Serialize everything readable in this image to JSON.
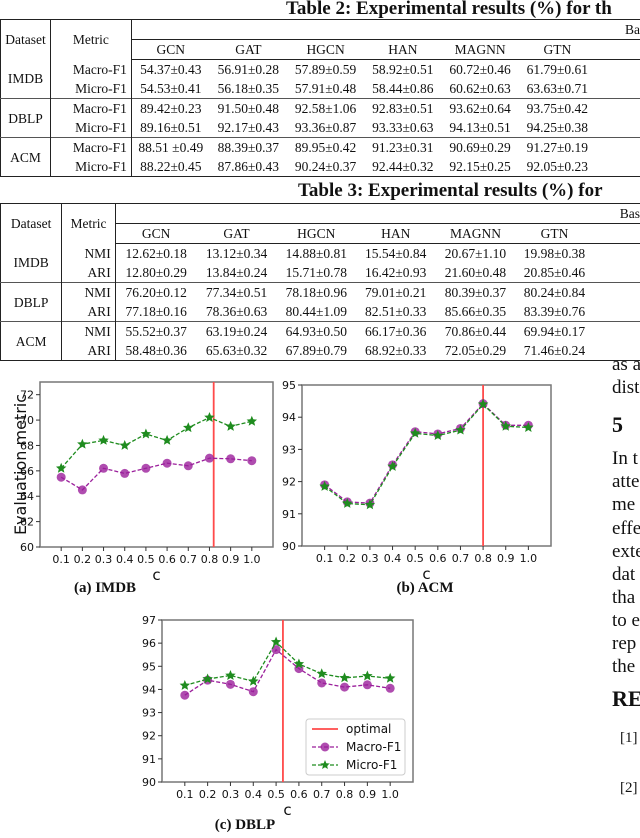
{
  "table2": {
    "title": "Table 2: Experimental results (%) for th",
    "group_header": "Ba",
    "headers": [
      "Dataset",
      "Metric",
      "GCN",
      "GAT",
      "HGCN",
      "HAN",
      "MAGNN",
      "GTN"
    ],
    "groups": [
      {
        "dataset": "IMDB",
        "rows": [
          {
            "metric": "Macro-F1",
            "values": [
              "54.37±0.43",
              "56.91±0.28",
              "57.89±0.59",
              "58.92±0.51",
              "60.72±0.46",
              "61.79±0.61"
            ]
          },
          {
            "metric": "Micro-F1",
            "values": [
              "54.53±0.41",
              "56.18±0.35",
              "57.91±0.48",
              "58.44±0.86",
              "60.62±0.63",
              "63.63±0.71"
            ]
          }
        ]
      },
      {
        "dataset": "DBLP",
        "rows": [
          {
            "metric": "Macro-F1",
            "values": [
              "89.42±0.23",
              "91.50±0.48",
              "92.58±1.06",
              "92.83±0.51",
              "93.62±0.64",
              "93.75±0.42"
            ]
          },
          {
            "metric": "Micro-F1",
            "values": [
              "89.16±0.51",
              "92.17±0.43",
              "93.36±0.87",
              "93.33±0.63",
              "94.13±0.51",
              "94.25±0.38"
            ]
          }
        ]
      },
      {
        "dataset": "ACM",
        "rows": [
          {
            "metric": "Macro-F1",
            "values": [
              "88.51 ±0.49",
              "88.39±0.37",
              "89.95±0.42",
              "91.23±0.31",
              "90.69±0.29",
              "91.27±0.19"
            ]
          },
          {
            "metric": "Micro-F1",
            "values": [
              "88.22±0.45",
              "87.86±0.43",
              "90.24±0.37",
              "92.44±0.32",
              "92.15±0.25",
              "92.05±0.23"
            ]
          }
        ]
      }
    ]
  },
  "table3": {
    "title": "Table 3: Experimental results (%) for",
    "group_header": "Bas",
    "headers": [
      "Dataset",
      "Metric",
      "GCN",
      "GAT",
      "HGCN",
      "HAN",
      "MAGNN",
      "GTN"
    ],
    "groups": [
      {
        "dataset": "IMDB",
        "rows": [
          {
            "metric": "NMI",
            "values": [
              "12.62±0.18",
              "13.12±0.34",
              "14.88±0.81",
              "15.54±0.84",
              "20.67±1.10",
              "19.98±0.38"
            ]
          },
          {
            "metric": "ARI",
            "values": [
              "12.80±0.29",
              "13.84±0.24",
              "15.71±0.78",
              "16.42±0.93",
              "21.60±0.48",
              "20.85±0.46"
            ]
          }
        ]
      },
      {
        "dataset": "DBLP",
        "rows": [
          {
            "metric": "NMI",
            "values": [
              "76.20±0.12",
              "77.34±0.51",
              "78.18±0.96",
              "79.01±0.21",
              "80.39±0.37",
              "80.24±0.84"
            ]
          },
          {
            "metric": "ARI",
            "values": [
              "77.18±0.16",
              "78.36±0.63",
              "80.44±1.09",
              "82.51±0.33",
              "85.66±0.35",
              "83.39±0.76"
            ]
          }
        ]
      },
      {
        "dataset": "ACM",
        "rows": [
          {
            "metric": "NMI",
            "values": [
              "55.52±0.37",
              "63.19±0.24",
              "64.93±0.50",
              "66.17±0.36",
              "70.86±0.44",
              "69.94±0.17"
            ]
          },
          {
            "metric": "ARI",
            "values": [
              "58.48±0.36",
              "65.63±0.32",
              "67.89±0.79",
              "68.92±0.33",
              "72.05±0.29",
              "71.46±0.24"
            ]
          }
        ]
      }
    ]
  },
  "side_text": {
    "lines": [
      "as a",
      "dist",
      "In t",
      "atte",
      "me",
      "effe",
      "exte",
      "dat",
      "tha",
      "to e",
      "rep",
      "the"
    ],
    "heading": "5",
    "refs_heading": "RE",
    "refs": [
      "[1]",
      "[2]"
    ]
  },
  "colors": {
    "macro": "#9b1f9b",
    "micro": "#1f8c1f",
    "optimal": "#ff4a4a"
  },
  "chart_data": [
    {
      "type": "line",
      "caption": "(a) IMDB",
      "xlabel": "c",
      "ylabel": "Evaluation metric",
      "x": [
        0.1,
        0.2,
        0.3,
        0.4,
        0.5,
        0.6,
        0.7,
        0.8,
        0.9,
        1.0
      ],
      "xtick_labels": [
        "0.1",
        "0.2",
        "0.3",
        "0.4",
        "0.5",
        "0.6",
        "0.7",
        "0.8",
        "0.9",
        "1.0"
      ],
      "xlim": [
        0,
        1.1
      ],
      "ylim": [
        60,
        73
      ],
      "yticks": [
        60,
        62,
        64,
        66,
        68,
        70,
        72
      ],
      "grid": false,
      "optimal_x": 0.82,
      "series": [
        {
          "name": "Macro-F1",
          "marker": "circle",
          "values": [
            65.5,
            64.5,
            66.2,
            65.8,
            66.2,
            66.6,
            66.4,
            67.0,
            66.95,
            66.8
          ]
        },
        {
          "name": "Micro-F1",
          "marker": "star",
          "values": [
            66.2,
            68.1,
            68.4,
            68.0,
            68.9,
            68.4,
            69.4,
            70.2,
            69.5,
            69.9
          ]
        }
      ]
    },
    {
      "type": "line",
      "caption": "(b) ACM",
      "xlabel": "c",
      "ylabel": "",
      "x": [
        0.1,
        0.2,
        0.3,
        0.4,
        0.5,
        0.6,
        0.7,
        0.8,
        0.9,
        1.0
      ],
      "xtick_labels": [
        "0.1",
        "0.2",
        "0.3",
        "0.4",
        "0.5",
        "0.6",
        "0.7",
        "0.8",
        "0.9",
        "1.0"
      ],
      "xlim": [
        0,
        1.1
      ],
      "ylim": [
        90,
        95
      ],
      "yticks": [
        90,
        91,
        92,
        93,
        94,
        95
      ],
      "grid": false,
      "optimal_x": 0.8,
      "series": [
        {
          "name": "Macro-F1",
          "marker": "circle",
          "values": [
            91.9,
            91.37,
            91.33,
            92.52,
            93.55,
            93.48,
            93.65,
            94.42,
            93.75,
            93.75
          ]
        },
        {
          "name": "Micro-F1",
          "marker": "star",
          "values": [
            91.85,
            91.32,
            91.28,
            92.47,
            93.5,
            93.43,
            93.6,
            94.4,
            93.72,
            93.68
          ]
        }
      ]
    },
    {
      "type": "line",
      "caption": "(c) DBLP",
      "xlabel": "c",
      "ylabel": "",
      "x": [
        0.1,
        0.2,
        0.3,
        0.4,
        0.5,
        0.6,
        0.7,
        0.8,
        0.9,
        1.0
      ],
      "xtick_labels": [
        "0.1",
        "0.2",
        "0.3",
        "0.4",
        "0.5",
        "0.6",
        "0.7",
        "0.8",
        "0.9",
        "1.0"
      ],
      "xlim": [
        0,
        1.1
      ],
      "ylim": [
        90,
        97
      ],
      "yticks": [
        90,
        91,
        92,
        93,
        94,
        95,
        96,
        97
      ],
      "grid": false,
      "optimal_x": 0.53,
      "legend": {
        "placement": "lower-right",
        "entries": [
          "optimal",
          "Macro-F1",
          "Micro-F1"
        ]
      },
      "series": [
        {
          "name": "Macro-F1",
          "marker": "circle",
          "values": [
            93.75,
            94.4,
            94.22,
            93.9,
            95.72,
            94.9,
            94.28,
            94.1,
            94.2,
            94.05
          ]
        },
        {
          "name": "Micro-F1",
          "marker": "star",
          "values": [
            94.17,
            94.45,
            94.6,
            94.35,
            96.05,
            95.1,
            94.68,
            94.5,
            94.58,
            94.48
          ]
        }
      ]
    }
  ]
}
